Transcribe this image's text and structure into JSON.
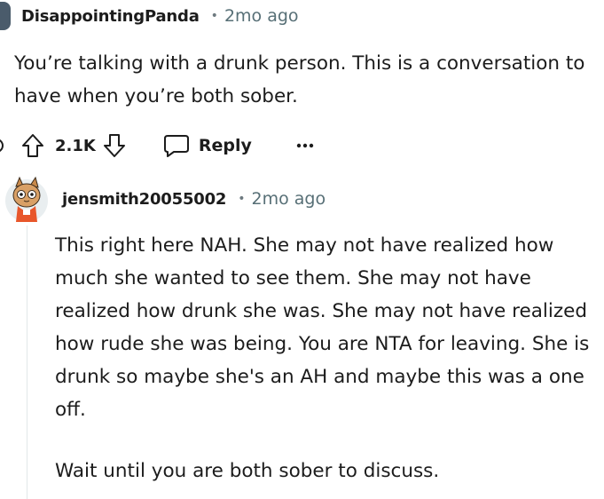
{
  "top_comment": {
    "username": "DisappointingPanda",
    "separator": "•",
    "time": "2mo ago",
    "body": "You’re talking with a drunk person. This is a conversation to have when you’re both sober.",
    "vote_count": "2.1K",
    "reply_label": "Reply",
    "more_label": "•••"
  },
  "reply_comment": {
    "username": "jensmith20055002",
    "separator": "•",
    "time": "2mo ago",
    "paragraphs": [
      "This right here NAH. She may not have realized how much she wanted to see them. She may not have realized how drunk she was. She may not have realized how rude she was being. You are NTA for leaving. She is drunk so maybe she's an AH and maybe this was a one off.",
      "Wait until you are both sober to discuss."
    ]
  },
  "icons": {
    "upvote": "upvote-arrow-icon",
    "downvote": "downvote-arrow-icon",
    "reply": "speech-bubble-icon",
    "more": "more-dots-icon"
  },
  "colors": {
    "text": "#1c1c1c",
    "meta": "#576f76",
    "thread_line": "#e2e7e9",
    "avatar_accent": "#e8562b"
  }
}
